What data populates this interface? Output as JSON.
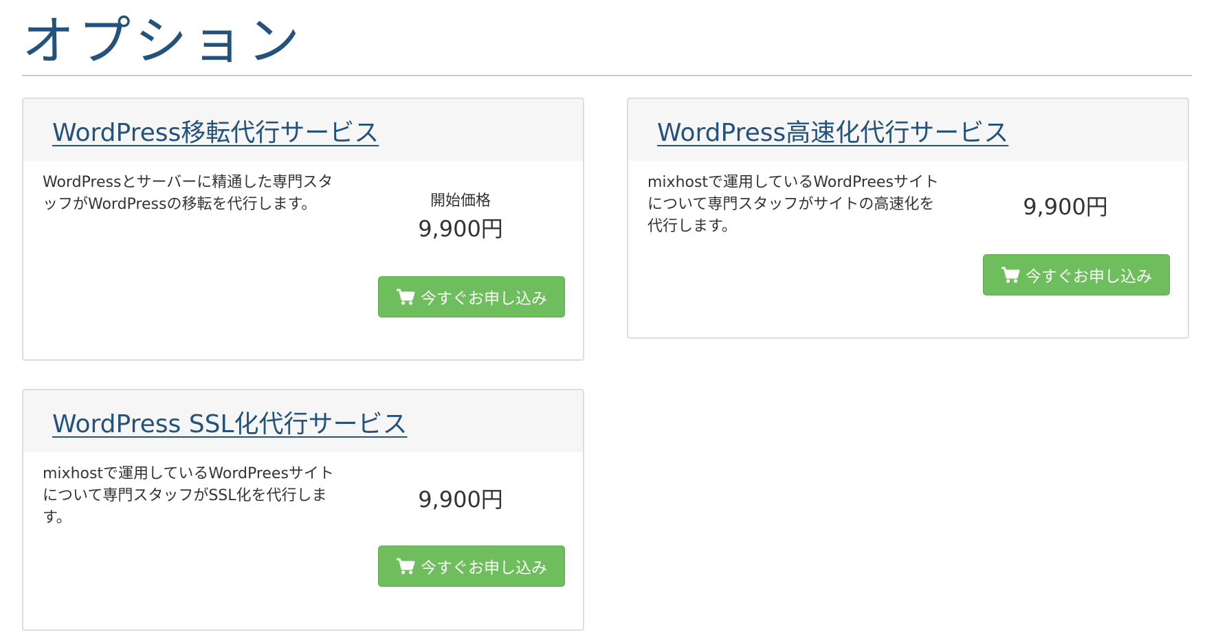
{
  "page": {
    "title": "オプション"
  },
  "colors": {
    "title": "#23527c",
    "link": "#23527c",
    "button": "#6fbe5e",
    "card_header": "#f6f6f6",
    "card_border": "#dddddd"
  },
  "icons": {
    "order_button": "shopping-cart-icon"
  },
  "options": [
    {
      "title": "WordPress移転代行サービス",
      "description": "WordPressとサーバーに精通した専門スタッフがWordPressの移転を代行します。",
      "price_label": "開始価格",
      "price": "9,900円",
      "button_label": "今すぐお申し込み"
    },
    {
      "title": "WordPress高速化代行サービス",
      "description": "mixhostで運用しているWordPreesサイトについて専門スタッフがサイトの高速化を代行します。",
      "price": "9,900円",
      "button_label": "今すぐお申し込み"
    },
    {
      "title": "WordPress SSL化代行サービス",
      "description": "mixhostで運用しているWordPreesサイトについて専門スタッフがSSL化を代行します。",
      "price": "9,900円",
      "button_label": "今すぐお申し込み"
    }
  ]
}
